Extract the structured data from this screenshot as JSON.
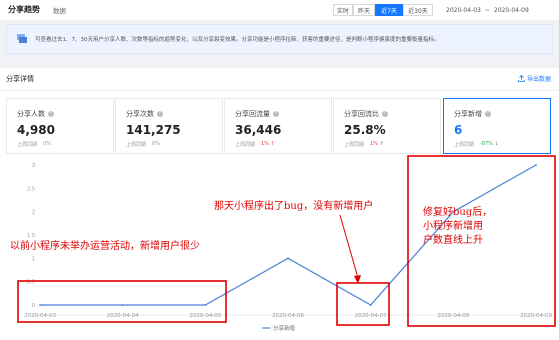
{
  "header": {
    "title": "分享趋势",
    "subtitle": "数据",
    "ranges": [
      "实时",
      "昨天",
      "近7天",
      "近30天"
    ],
    "active_range": "近7天",
    "date_start": "2020-04-03",
    "date_sep": "~",
    "date_end": "2020-04-09"
  },
  "notice": {
    "text": "可查看过去1、7、30天用户分享人数、次数等指标的趋势变化，以及分享裂变效果。分享功能是小程序拉新、获客的重要途径，是判断小程序健康度的重要衡量指标。"
  },
  "panel": {
    "title": "分享详情",
    "export_label": "导出数据"
  },
  "cards": [
    {
      "label": "分享人数",
      "value": "4,980",
      "cmp_label": "上周同期",
      "cmp_value": "0%",
      "trend": "none"
    },
    {
      "label": "分享次数",
      "value": "141,275",
      "cmp_label": "上周同期",
      "cmp_value": "0%",
      "trend": "none"
    },
    {
      "label": "分享回流量",
      "value": "36,446",
      "cmp_label": "上周同期",
      "cmp_value": "1%",
      "trend": "up"
    },
    {
      "label": "分享回流比",
      "value": "25.8%",
      "cmp_label": "上周同期",
      "cmp_value": "1%",
      "trend": "up"
    },
    {
      "label": "分享新增",
      "value": "6",
      "cmp_label": "上周同期",
      "cmp_value": "-87%",
      "trend": "down"
    }
  ],
  "chart_data": {
    "type": "line",
    "x": [
      "2020-04-03",
      "2020-04-04",
      "2020-04-05",
      "2020-04-06",
      "2020-04-07",
      "2020-04-08",
      "2020-04-09"
    ],
    "series": [
      {
        "name": "分享新增",
        "values": [
          0,
          0,
          0,
          1,
          0,
          2,
          3
        ]
      }
    ],
    "ylim": [
      0,
      3
    ],
    "yticks": [
      "0",
      "0.5",
      "1",
      "1.5",
      "2",
      "2.5",
      "3"
    ],
    "legend": "bottom-center",
    "line_color": "#4a80d8",
    "grid": false
  },
  "annotations": {
    "left": "以前小程序未举办运营活动，新增用户很少",
    "middle": "那天小程序出了bug，没有新增用户",
    "right_lines": [
      "修复好bug后，",
      "小程序新增用",
      "户数直线上升"
    ],
    "color": "#e00000"
  }
}
